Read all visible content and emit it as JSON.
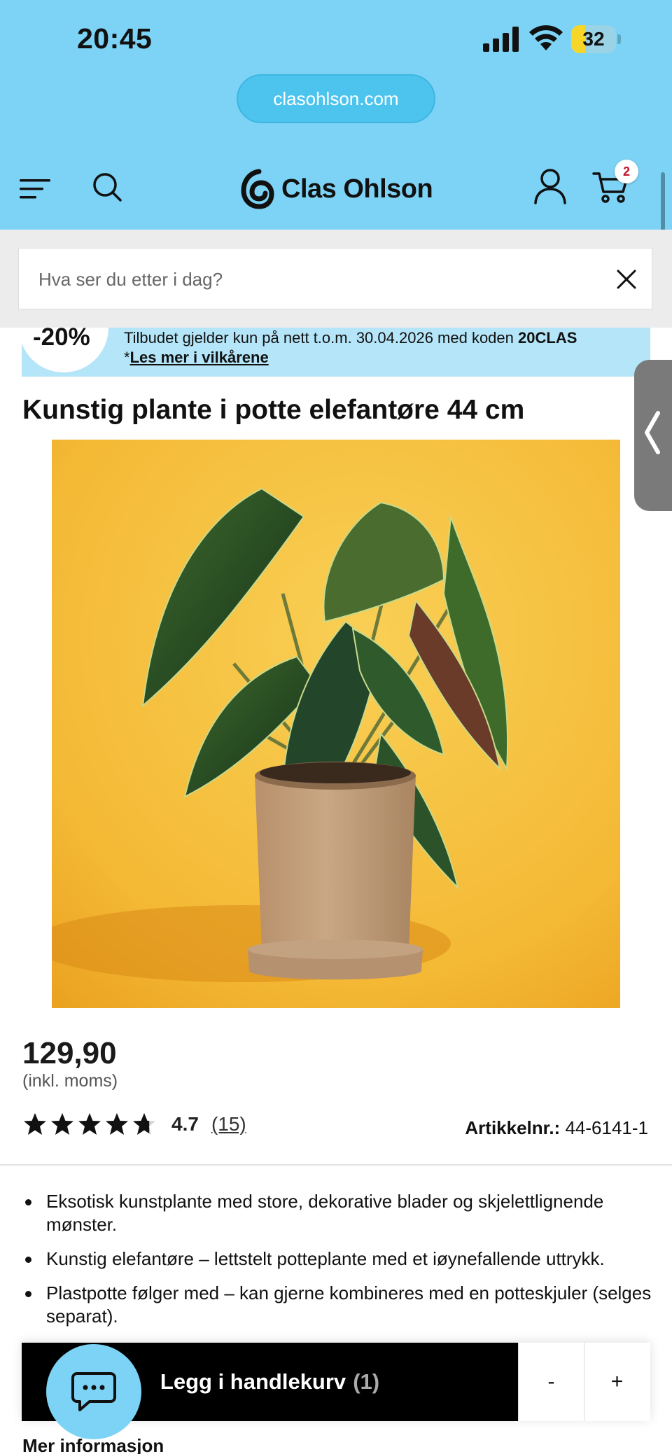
{
  "status_bar": {
    "time": "20:45",
    "battery": "32",
    "battery_level": 0.32
  },
  "browser": {
    "url": "clasohlson.com"
  },
  "header": {
    "logo_text": "Clas Ohlson",
    "cart_count": "2"
  },
  "search": {
    "placeholder": "Hva ser du etter i dag?"
  },
  "promo": {
    "badge": "-20%",
    "text": "Tilbudet gjelder kun på nett t.o.m. 30.04.2026 med koden",
    "code": "20CLAS",
    "link_prefix": "*",
    "link": "Les mer i vilkårene"
  },
  "product": {
    "title": "Kunstig plante i potte elefantøre 44 cm",
    "price": "129,90",
    "vat_note": "(inkl. moms)",
    "rating": "4.7",
    "rating_value": 4.7,
    "review_count": "(15)",
    "article_label": "Artikkelnr.:",
    "article_number": "44-6141-1",
    "bullets": [
      "Eksotisk kunstplante med store, dekorative blader og skjelettlignende mønster.",
      "Kunstig elefantøre – lettstelt potteplante med et iøynefallende uttrykk.",
      "Plastpotte følger med – kan gjerne kombineres med en potteskjuler (selges separat)."
    ]
  },
  "cart_bar": {
    "add_label": "Legg i handlekurv",
    "quantity": "(1)",
    "minus": "-",
    "plus": "+"
  },
  "more_info": "Mer informasjon",
  "colors": {
    "header": "#7dd3f5",
    "promo": "#b5e5f8",
    "button": "#000000",
    "badge": "#c0172c"
  }
}
